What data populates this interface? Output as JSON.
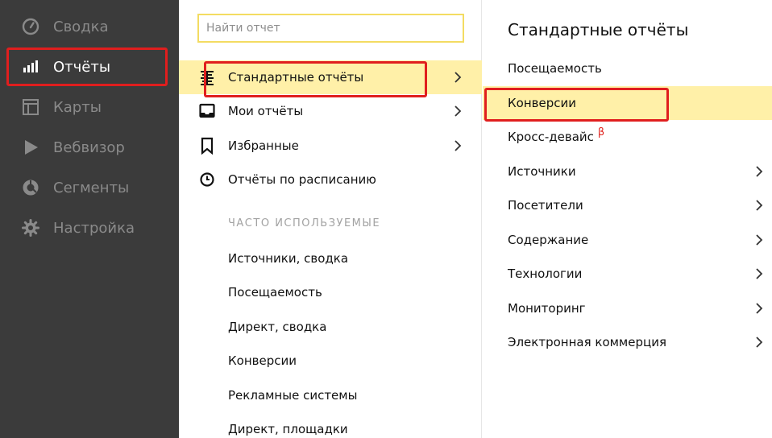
{
  "sidebar": {
    "items": [
      {
        "label": "Сводка",
        "icon": "speedometer-icon"
      },
      {
        "label": "Отчёты",
        "icon": "bar-chart-icon",
        "active": true
      },
      {
        "label": "Карты",
        "icon": "map-layout-icon"
      },
      {
        "label": "Вебвизор",
        "icon": "play-icon"
      },
      {
        "label": "Сегменты",
        "icon": "donut-icon"
      },
      {
        "label": "Настройка",
        "icon": "gear-icon"
      }
    ]
  },
  "middle": {
    "search_placeholder": "Найти отчет",
    "rows": [
      {
        "label": "Стандартные отчёты",
        "icon": "list-icon",
        "chevron": true,
        "active": true
      },
      {
        "label": "Мои отчёты",
        "icon": "inbox-icon",
        "chevron": true
      },
      {
        "label": "Избранные",
        "icon": "bookmark-icon",
        "chevron": true
      },
      {
        "label": "Отчёты по расписанию",
        "icon": "clock-icon",
        "chevron": false
      }
    ],
    "section_title": "ЧАСТО ИСПОЛЬЗУЕМЫЕ",
    "frequent": [
      "Источники, сводка",
      "Посещаемость",
      "Директ, сводка",
      "Конверсии",
      "Рекламные системы",
      "Директ, площадки"
    ]
  },
  "right": {
    "title": "Стандартные отчёты",
    "rows": [
      {
        "label": "Посещаемость",
        "chevron": false
      },
      {
        "label": "Конверсии",
        "chevron": false,
        "active": true
      },
      {
        "label": "Кросс-девайс",
        "chevron": false,
        "badge": "β"
      },
      {
        "label": "Источники",
        "chevron": true
      },
      {
        "label": "Посетители",
        "chevron": true
      },
      {
        "label": "Содержание",
        "chevron": true
      },
      {
        "label": "Технологии",
        "chevron": true
      },
      {
        "label": "Мониторинг",
        "chevron": true
      },
      {
        "label": "Электронная коммерция",
        "chevron": true
      }
    ]
  },
  "colors": {
    "sidebar_bg": "#3b3b3b",
    "active_row": "#fff0a8",
    "highlight_border": "#e01e1e",
    "search_border": "#f3dc62"
  }
}
